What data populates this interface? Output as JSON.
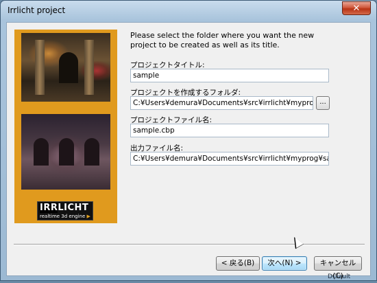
{
  "window": {
    "title": "Irrlicht project",
    "close_glyph": "✕"
  },
  "side_panel": {
    "logo_main_irr": "IRR",
    "logo_main_licht": "LICHT",
    "logo_sub": "realtime 3d engine",
    "logo_arrow": "▶"
  },
  "form": {
    "intro": "Please select the folder where you want the new project to be created as well as its title.",
    "project_title_label": "プロジェクトタイトル:",
    "project_title_value": "sample",
    "folder_label": "プロジェクトを作成するフォルダ:",
    "folder_value": "C:¥Users¥demura¥Documents¥src¥irrlicht¥myprog¥",
    "browse_label": "...",
    "project_file_label": "プロジェクトファイル名:",
    "project_file_value": "sample.cbp",
    "output_file_label": "出力ファイル名:",
    "output_file_value": "C:¥Users¥demura¥Documents¥src¥irrlicht¥myprog¥sample"
  },
  "buttons": {
    "back": "< 戻る(B)",
    "next": "次へ(N) >",
    "cancel": "キャンセル(C)"
  },
  "background": {
    "text": "DCIault"
  }
}
